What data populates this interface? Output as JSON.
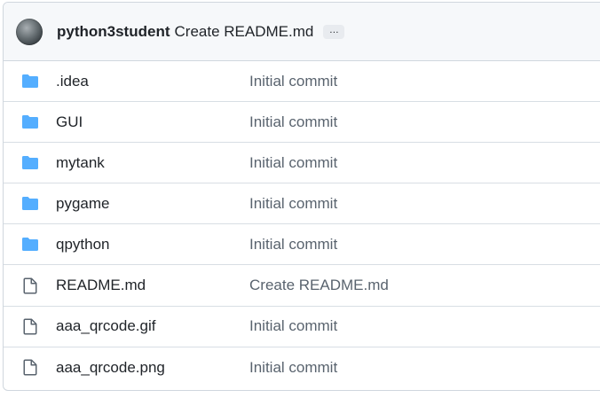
{
  "latest_commit": {
    "author": "python3student",
    "message": "Create README.md",
    "more_label": "…"
  },
  "files": [
    {
      "name": ".idea",
      "type": "folder",
      "icon": "folder-icon",
      "commit": "Initial commit"
    },
    {
      "name": "GUI",
      "type": "folder",
      "icon": "folder-icon",
      "commit": "Initial commit"
    },
    {
      "name": "mytank",
      "type": "folder",
      "icon": "folder-icon",
      "commit": "Initial commit"
    },
    {
      "name": "pygame",
      "type": "folder",
      "icon": "folder-icon",
      "commit": "Initial commit"
    },
    {
      "name": "qpython",
      "type": "folder",
      "icon": "folder-icon",
      "commit": "Initial commit"
    },
    {
      "name": "README.md",
      "type": "file",
      "icon": "file-icon",
      "commit": "Create README.md"
    },
    {
      "name": "aaa_qrcode.gif",
      "type": "file",
      "icon": "file-icon",
      "commit": "Initial commit"
    },
    {
      "name": "aaa_qrcode.png",
      "type": "file",
      "icon": "file-icon",
      "commit": "Initial commit"
    }
  ],
  "colors": {
    "folder": "#54aeff",
    "file_icon": "#59636e",
    "header_bg": "#f6f8fa",
    "border": "#d0d7de"
  }
}
